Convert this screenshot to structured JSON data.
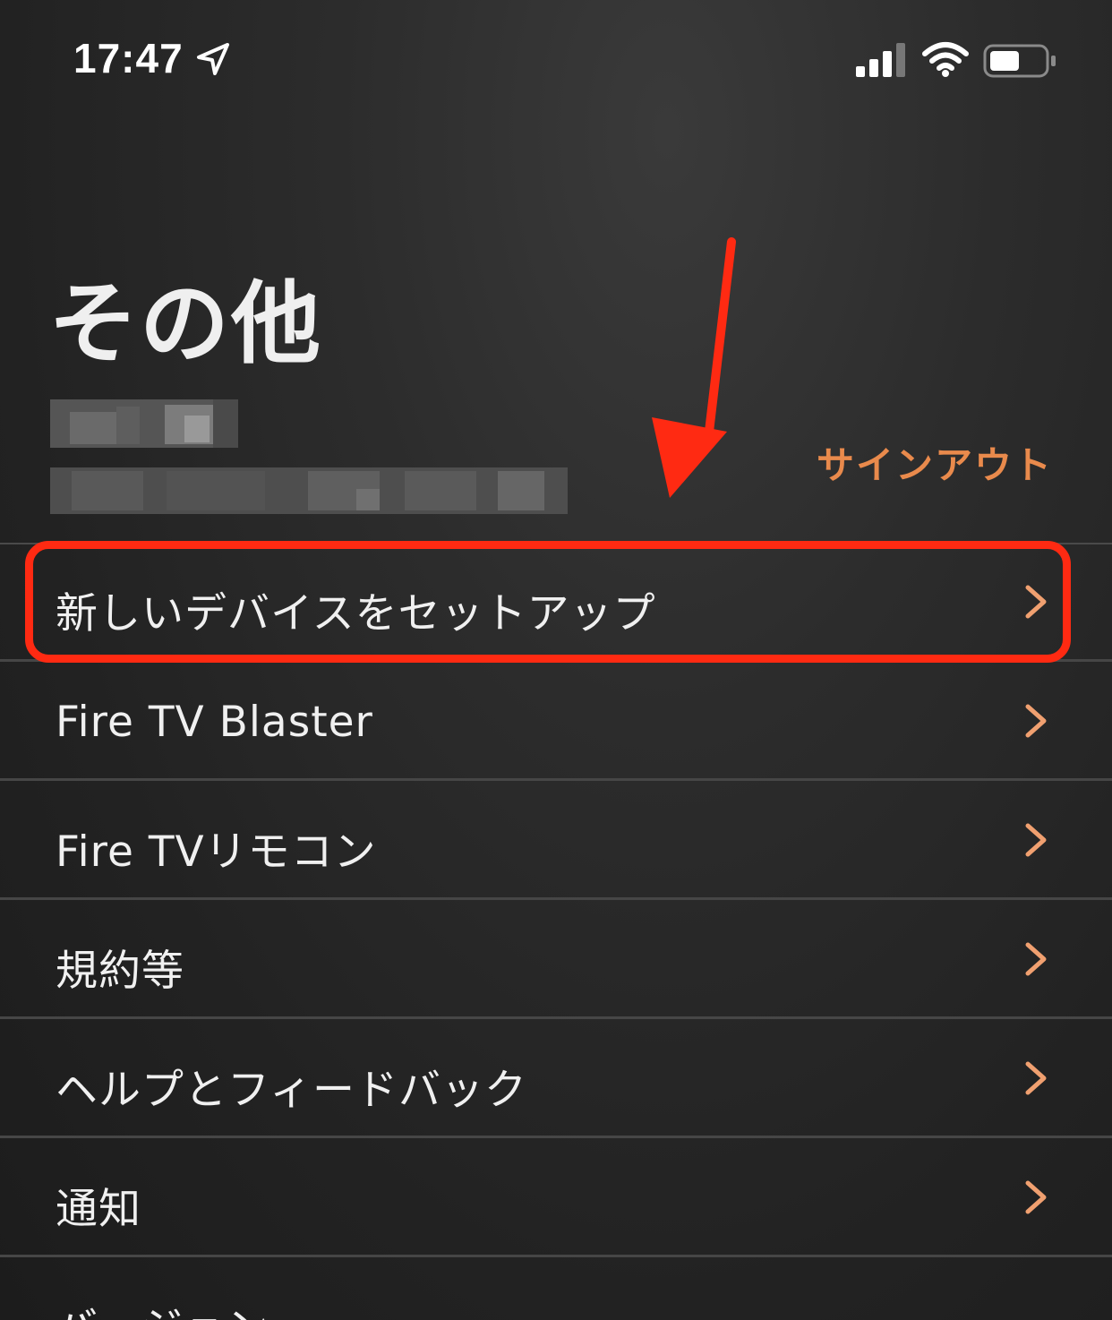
{
  "status_bar": {
    "time": "17:47",
    "icons": [
      "location-arrow-icon",
      "cellular-signal-icon",
      "wifi-icon",
      "battery-icon"
    ]
  },
  "header": {
    "title": "その他"
  },
  "account": {
    "signout_label": "サインアウト"
  },
  "menu": {
    "items": [
      {
        "label": "新しいデバイスをセットアップ",
        "icon": "chevron-right-icon"
      },
      {
        "label": "Fire TV Blaster",
        "icon": "chevron-right-icon"
      },
      {
        "label": "Fire TVリモコン",
        "icon": "chevron-right-icon"
      },
      {
        "label": "規約等",
        "icon": "chevron-right-icon"
      },
      {
        "label": "ヘルプとフィードバック",
        "icon": "chevron-right-icon"
      },
      {
        "label": "通知",
        "icon": "chevron-right-icon"
      },
      {
        "label": "バージョン",
        "icon": ""
      }
    ]
  },
  "colors": {
    "accent": "#e98a4c",
    "annotation": "#ff2a12",
    "background": "#1e1e1e",
    "divider": "#464646"
  }
}
